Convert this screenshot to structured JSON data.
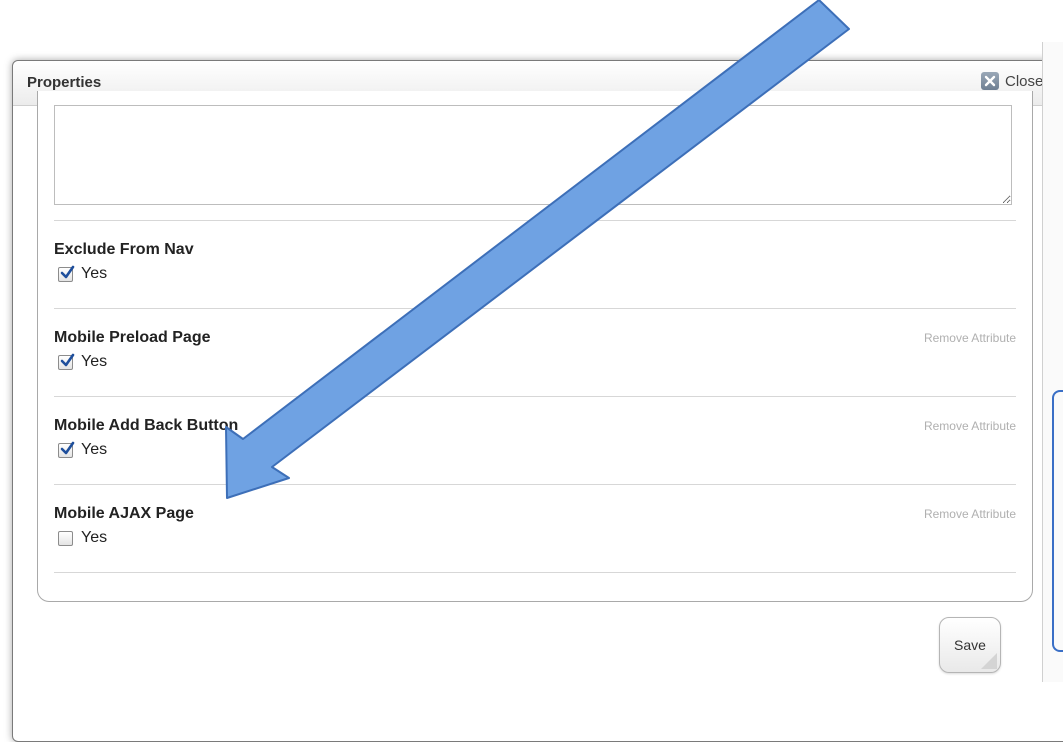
{
  "window": {
    "title": "Properties",
    "close_label": "Close"
  },
  "description": {
    "value": ""
  },
  "attributes": [
    {
      "label": "Exclude From Nav",
      "checkbox_label": "Yes",
      "checked": true,
      "remove_label": ""
    },
    {
      "label": "Mobile Preload Page",
      "checkbox_label": "Yes",
      "checked": true,
      "remove_label": "Remove Attribute"
    },
    {
      "label": "Mobile Add Back Button",
      "checkbox_label": "Yes",
      "checked": true,
      "remove_label": "Remove Attribute"
    },
    {
      "label": "Mobile AJAX Page",
      "checkbox_label": "Yes",
      "checked": false,
      "remove_label": "Remove Attribute"
    }
  ],
  "actions": {
    "save_label": "Save"
  },
  "colors": {
    "arrow_fill": "#6fa2e3",
    "arrow_stroke": "#3d6fb8",
    "checkmark": "#1f4f9c",
    "remove_link": "#b0b0b0",
    "accent_blue": "#3a6fc6"
  },
  "icons": {
    "close": "close-x-icon",
    "checkmark": "checkmark-icon",
    "arrow": "annotation-arrow-icon"
  }
}
